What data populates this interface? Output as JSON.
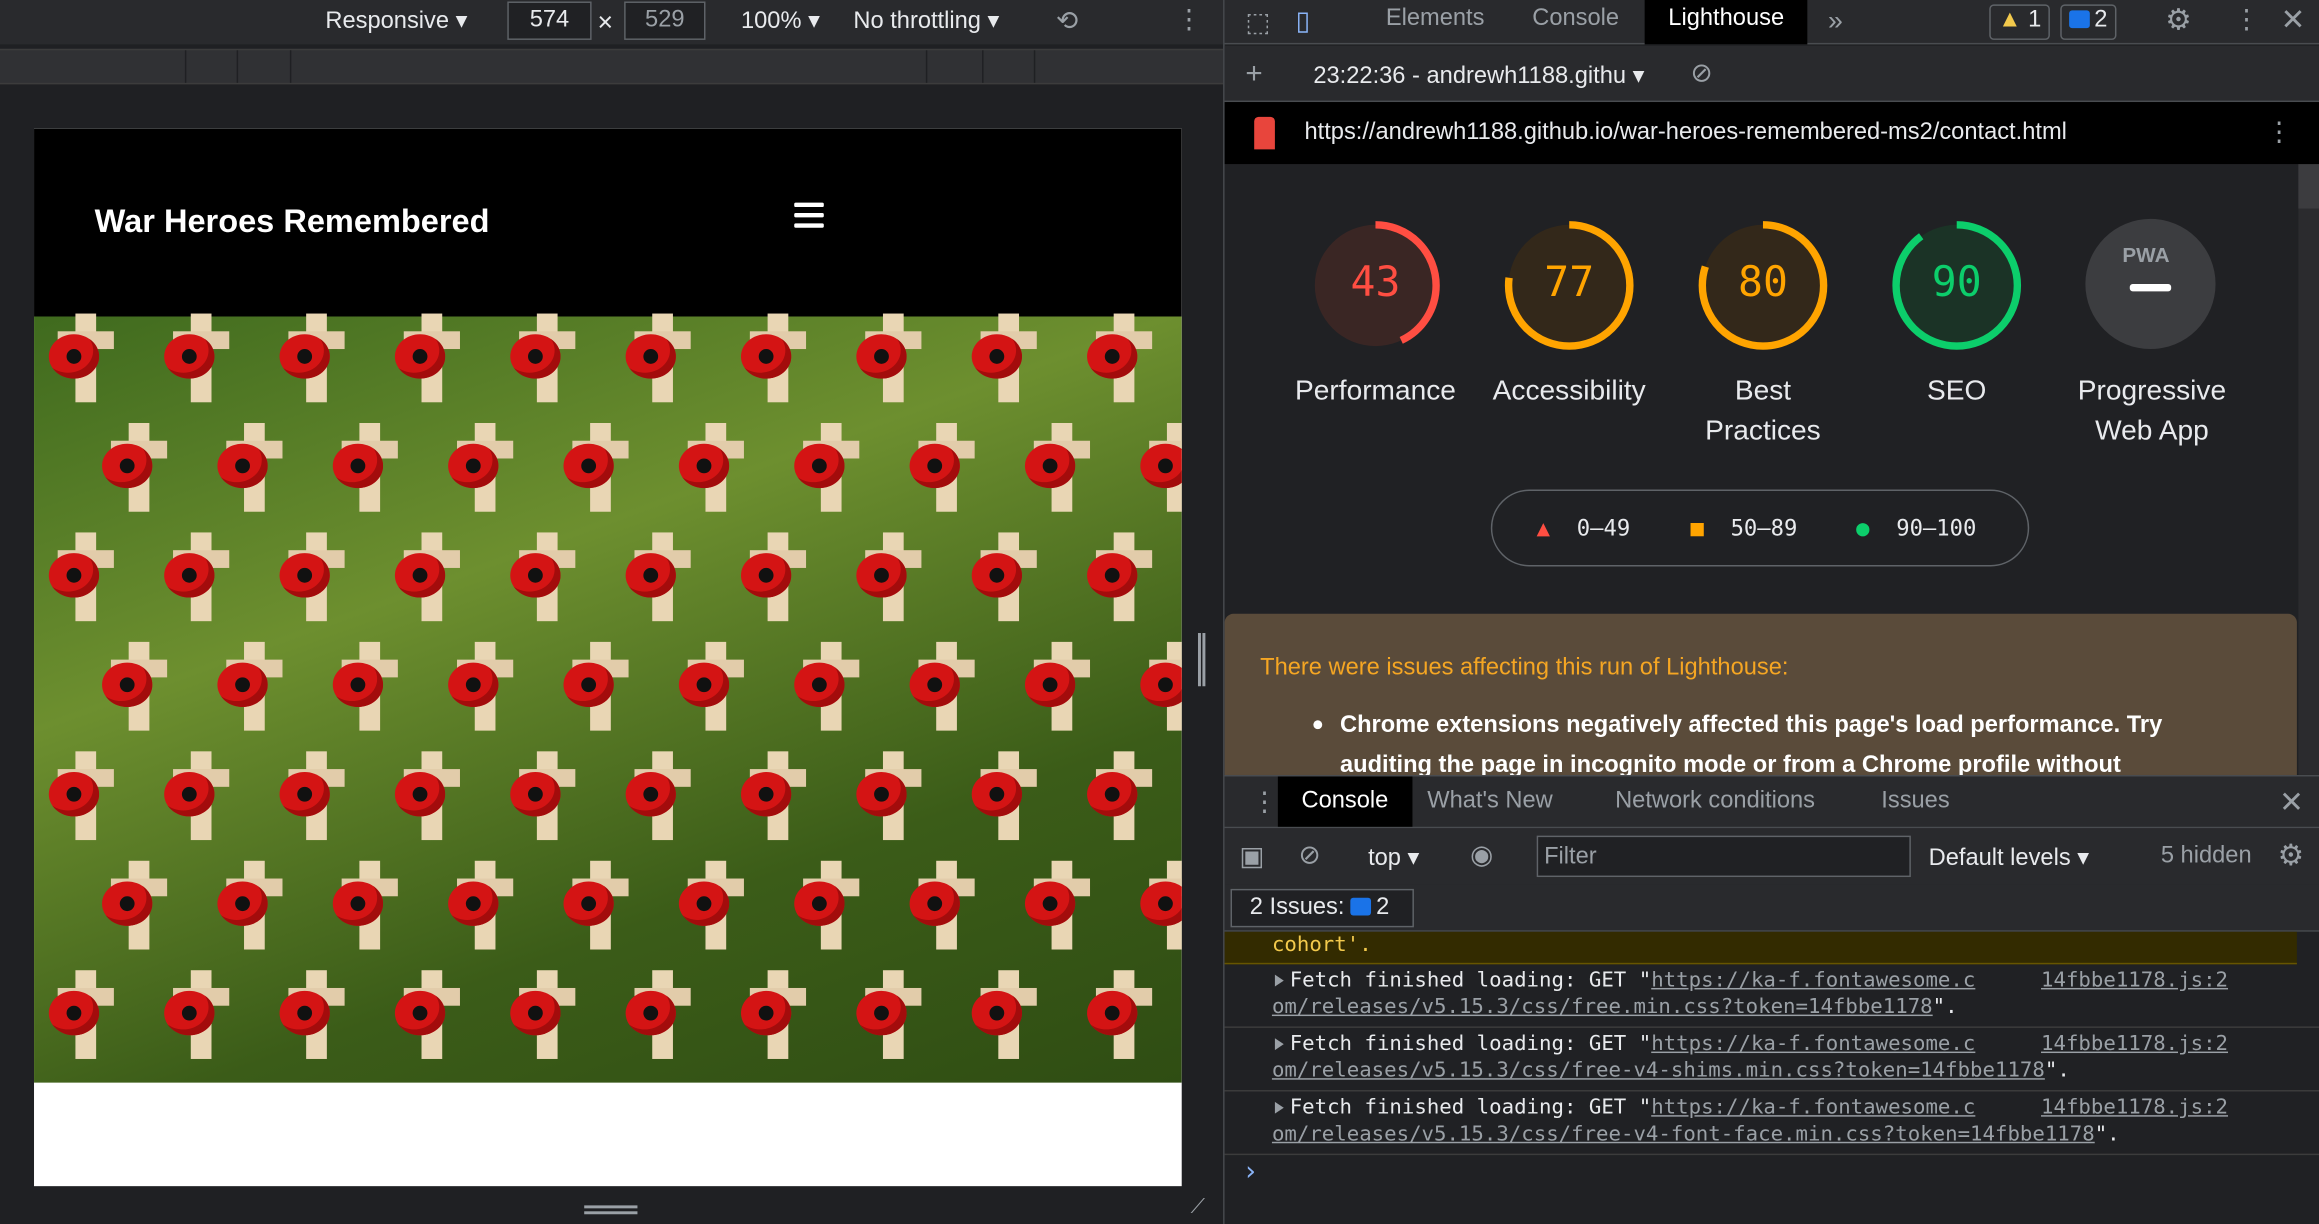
{
  "device_toolbar": {
    "device": "Responsive",
    "width": "574",
    "times": "×",
    "height": "529",
    "zoom": "100%",
    "throttling": "No throttling"
  },
  "site": {
    "brand": "War Heroes Remembered"
  },
  "devtools": {
    "tabs": [
      "Elements",
      "Console",
      "Lighthouse"
    ],
    "active_tab": "Lighthouse",
    "warning_count": "1",
    "issue_count": "2",
    "report_selector": "23:22:36 - andrewh1188.githu",
    "url": "https://andrewh1188.github.io/war-heroes-remembered-ms2/contact.html"
  },
  "lighthouse": {
    "scores": [
      {
        "label": "Performance",
        "value": "43",
        "fraction": 0.43,
        "color": "#ff4e42",
        "bg": "#3a2624"
      },
      {
        "label": "Accessibility",
        "value": "77",
        "fraction": 0.77,
        "color": "#ffa400",
        "bg": "#33281a"
      },
      {
        "label": "Best Practices",
        "value": "80",
        "fraction": 0.8,
        "color": "#ffa400",
        "bg": "#33281a"
      },
      {
        "label": "SEO",
        "value": "90",
        "fraction": 0.9,
        "color": "#0cce6b",
        "bg": "#1b3326"
      }
    ],
    "pwa": {
      "label_line1": "Progressive",
      "label_line2": "Web App",
      "badge": "PWA"
    },
    "legend": [
      {
        "range": "0–49",
        "color": "#ff4e42",
        "shape": "triangle"
      },
      {
        "range": "50–89",
        "color": "#ffa400",
        "shape": "square"
      },
      {
        "range": "90–100",
        "color": "#0cce6b",
        "shape": "circle"
      }
    ],
    "warning_title": "There were issues affecting this run of Lighthouse:",
    "warning_body": "Chrome extensions negatively affected this page's load performance. Try auditing the page in incognito mode or from a Chrome profile without"
  },
  "drawer": {
    "tabs": [
      "Console",
      "What's New",
      "Network conditions",
      "Issues"
    ],
    "active_tab": "Console",
    "context": "top",
    "filter_placeholder": "Filter",
    "levels": "Default levels",
    "hidden": "5 hidden",
    "issues_label": "2 Issues:",
    "issues_count": "2"
  },
  "console": {
    "warning_tail": "cohort'.",
    "messages": [
      {
        "prefix": "Fetch finished loading: GET \"",
        "link1": "https://ka-f.fontawesome.c",
        "link2": "om/releases/v5.15.3/css/free.min.css?token=14fbbe1178",
        "suffix": "\".",
        "source": "14fbbe1178.js:2"
      },
      {
        "prefix": "Fetch finished loading: GET \"",
        "link1": "https://ka-f.fontawesome.c",
        "link2": "om/releases/v5.15.3/css/free-v4-shims.min.css?token=14fbbe1178",
        "suffix": "\".",
        "source": "14fbbe1178.js:2"
      },
      {
        "prefix": "Fetch finished loading: GET \"",
        "link1": "https://ka-f.fontawesome.c",
        "link2": "om/releases/v5.15.3/css/free-v4-font-face.min.css?token=14fbbe1178",
        "suffix": "\".",
        "source": "14fbbe1178.js:2"
      }
    ],
    "prompt": "›"
  }
}
